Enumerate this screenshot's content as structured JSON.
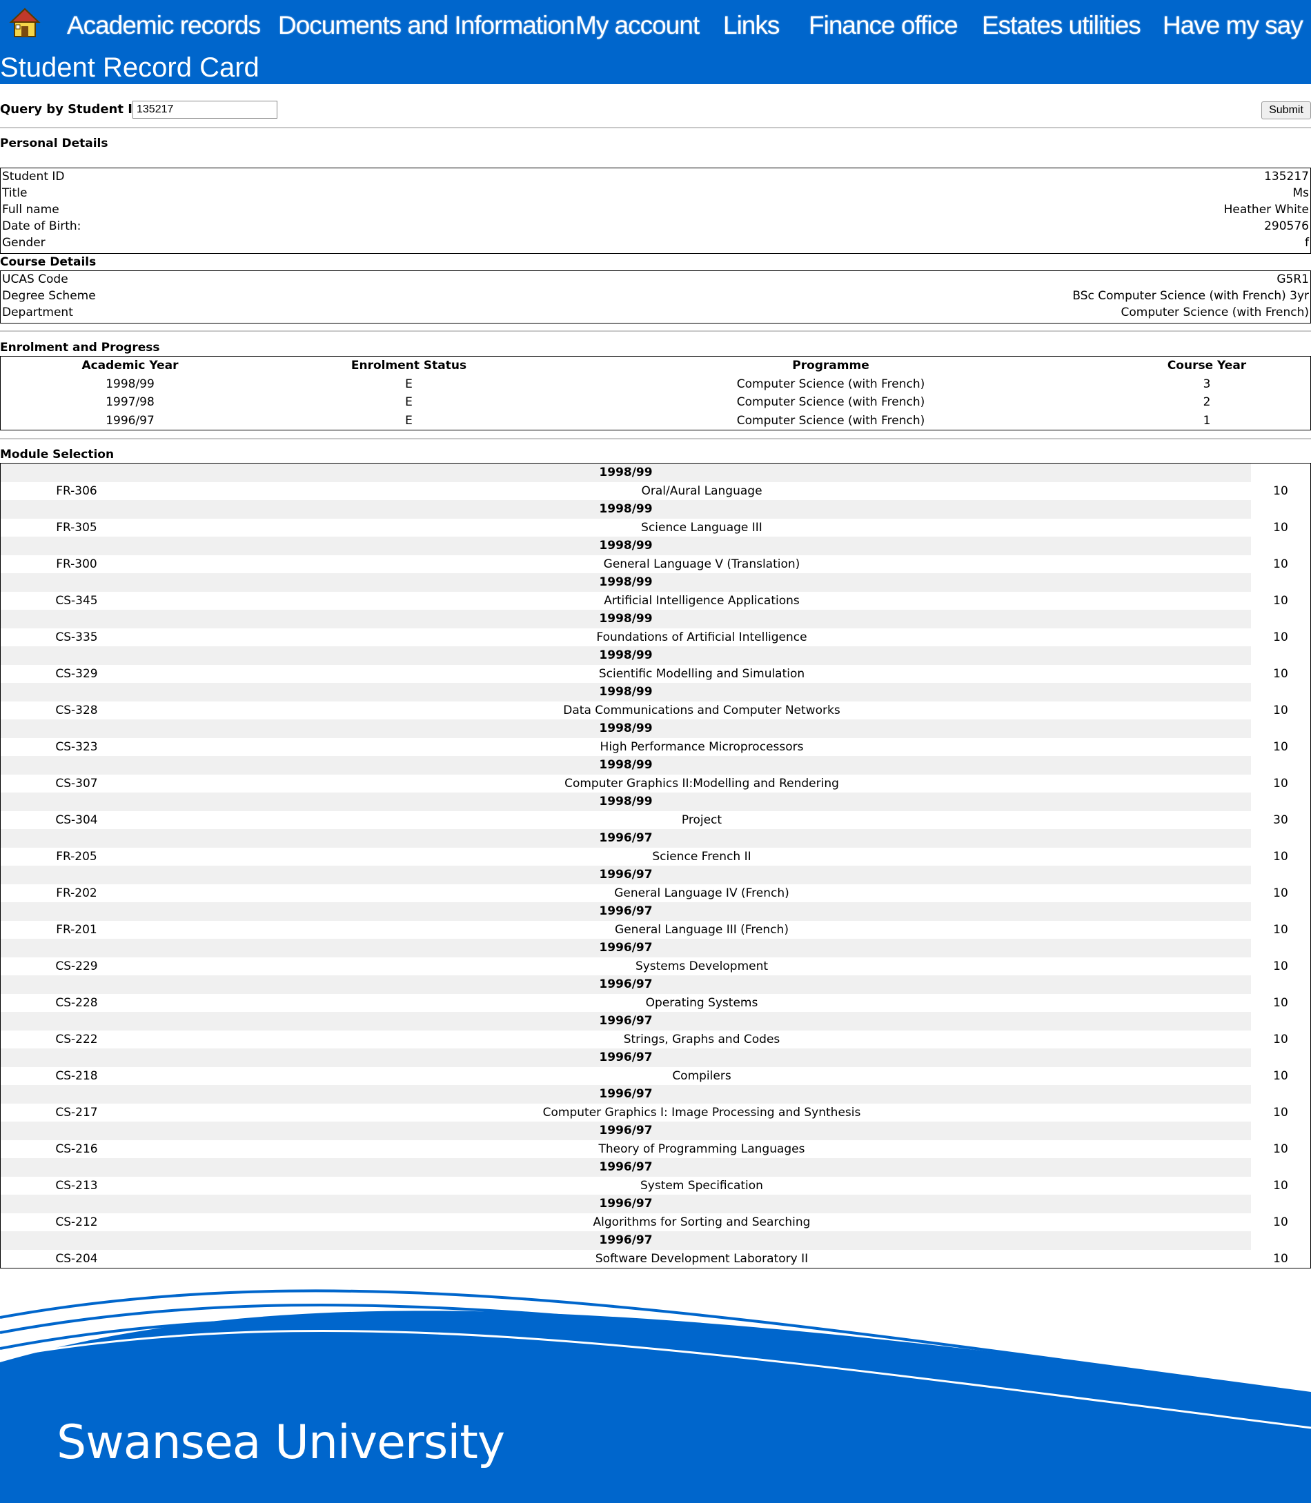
{
  "nav": {
    "items": [
      {
        "label": "Academic records",
        "name": "nav-academic-records"
      },
      {
        "label": "Documents and Information",
        "name": "nav-documents-information"
      },
      {
        "label": "My account",
        "name": "nav-my-account"
      },
      {
        "label": "Links",
        "name": "nav-links"
      },
      {
        "label": "Finance office",
        "name": "nav-finance-office"
      },
      {
        "label": "Estates utilities",
        "name": "nav-estates-utilities"
      },
      {
        "label": "Have my say",
        "name": "nav-have-my-say"
      }
    ],
    "home_icon": "home-icon"
  },
  "page": {
    "title": "Student Record Card"
  },
  "query": {
    "label": "Query by Student ID #:",
    "value": "135217",
    "submit_label": "Submit"
  },
  "personal": {
    "heading": "Personal Details",
    "rows": [
      {
        "label": "Student ID",
        "value": "135217"
      },
      {
        "label": "Title",
        "value": "Ms"
      },
      {
        "label": "Full name",
        "value": "Heather White"
      },
      {
        "label": "Date of Birth:",
        "value": "290576"
      },
      {
        "label": "Gender",
        "value": "f"
      }
    ]
  },
  "course": {
    "heading": "Course Details",
    "rows": [
      {
        "label": "UCAS Code",
        "value": "G5R1"
      },
      {
        "label": "Degree Scheme",
        "value": "BSc Computer Science (with French) 3yr"
      },
      {
        "label": "Department",
        "value": "Computer Science (with French)"
      }
    ]
  },
  "enrolment": {
    "heading": "Enrolment and Progress",
    "columns": [
      "Academic Year",
      "Enrolment Status",
      "Programme",
      "Course Year"
    ],
    "rows": [
      [
        "1998/99",
        "E",
        "Computer Science (with French)",
        "3"
      ],
      [
        "1997/98",
        "E",
        "Computer Science (with French)",
        "2"
      ],
      [
        "1996/97",
        "E",
        "Computer Science (with French)",
        "1"
      ]
    ]
  },
  "modules": {
    "heading": "Module Selection",
    "rows": [
      {
        "year": "1998/99",
        "code": "FR-306",
        "title": "Oral/Aural Language",
        "credits": "10"
      },
      {
        "year": "1998/99",
        "code": "FR-305",
        "title": "Science Language III",
        "credits": "10"
      },
      {
        "year": "1998/99",
        "code": "FR-300",
        "title": "General Language V (Translation)",
        "credits": "10"
      },
      {
        "year": "1998/99",
        "code": "CS-345",
        "title": "Artificial Intelligence Applications",
        "credits": "10"
      },
      {
        "year": "1998/99",
        "code": "CS-335",
        "title": "Foundations of Artificial Intelligence",
        "credits": "10"
      },
      {
        "year": "1998/99",
        "code": "CS-329",
        "title": "Scientific Modelling and Simulation",
        "credits": "10"
      },
      {
        "year": "1998/99",
        "code": "CS-328",
        "title": "Data Communications and Computer Networks",
        "credits": "10"
      },
      {
        "year": "1998/99",
        "code": "CS-323",
        "title": "High Performance Microprocessors",
        "credits": "10"
      },
      {
        "year": "1998/99",
        "code": "CS-307",
        "title": "Computer Graphics II:Modelling and Rendering",
        "credits": "10"
      },
      {
        "year": "1998/99",
        "code": "CS-304",
        "title": "Project",
        "credits": "30"
      },
      {
        "year": "1996/97",
        "code": "FR-205",
        "title": "Science French II",
        "credits": "10"
      },
      {
        "year": "1996/97",
        "code": "FR-202",
        "title": "General Language IV (French)",
        "credits": "10"
      },
      {
        "year": "1996/97",
        "code": "FR-201",
        "title": "General Language III (French)",
        "credits": "10"
      },
      {
        "year": "1996/97",
        "code": "CS-229",
        "title": "Systems Development",
        "credits": "10"
      },
      {
        "year": "1996/97",
        "code": "CS-228",
        "title": "Operating Systems",
        "credits": "10"
      },
      {
        "year": "1996/97",
        "code": "CS-222",
        "title": "Strings, Graphs and Codes",
        "credits": "10"
      },
      {
        "year": "1996/97",
        "code": "CS-218",
        "title": "Compilers",
        "credits": "10"
      },
      {
        "year": "1996/97",
        "code": "CS-217",
        "title": "Computer Graphics I: Image Processing and Synthesis",
        "credits": "10"
      },
      {
        "year": "1996/97",
        "code": "CS-216",
        "title": "Theory of Programming Languages",
        "credits": "10"
      },
      {
        "year": "1996/97",
        "code": "CS-213",
        "title": "System Specification",
        "credits": "10"
      },
      {
        "year": "1996/97",
        "code": "CS-212",
        "title": "Algorithms for Sorting and Searching",
        "credits": "10"
      },
      {
        "year": "1996/97",
        "code": "CS-204",
        "title": "Software Development Laboratory II",
        "credits": "10"
      }
    ]
  },
  "footer": {
    "brand": "Swansea University"
  },
  "colors": {
    "brand_blue": "#0066cc",
    "row_shade": "#f0f0f0"
  }
}
